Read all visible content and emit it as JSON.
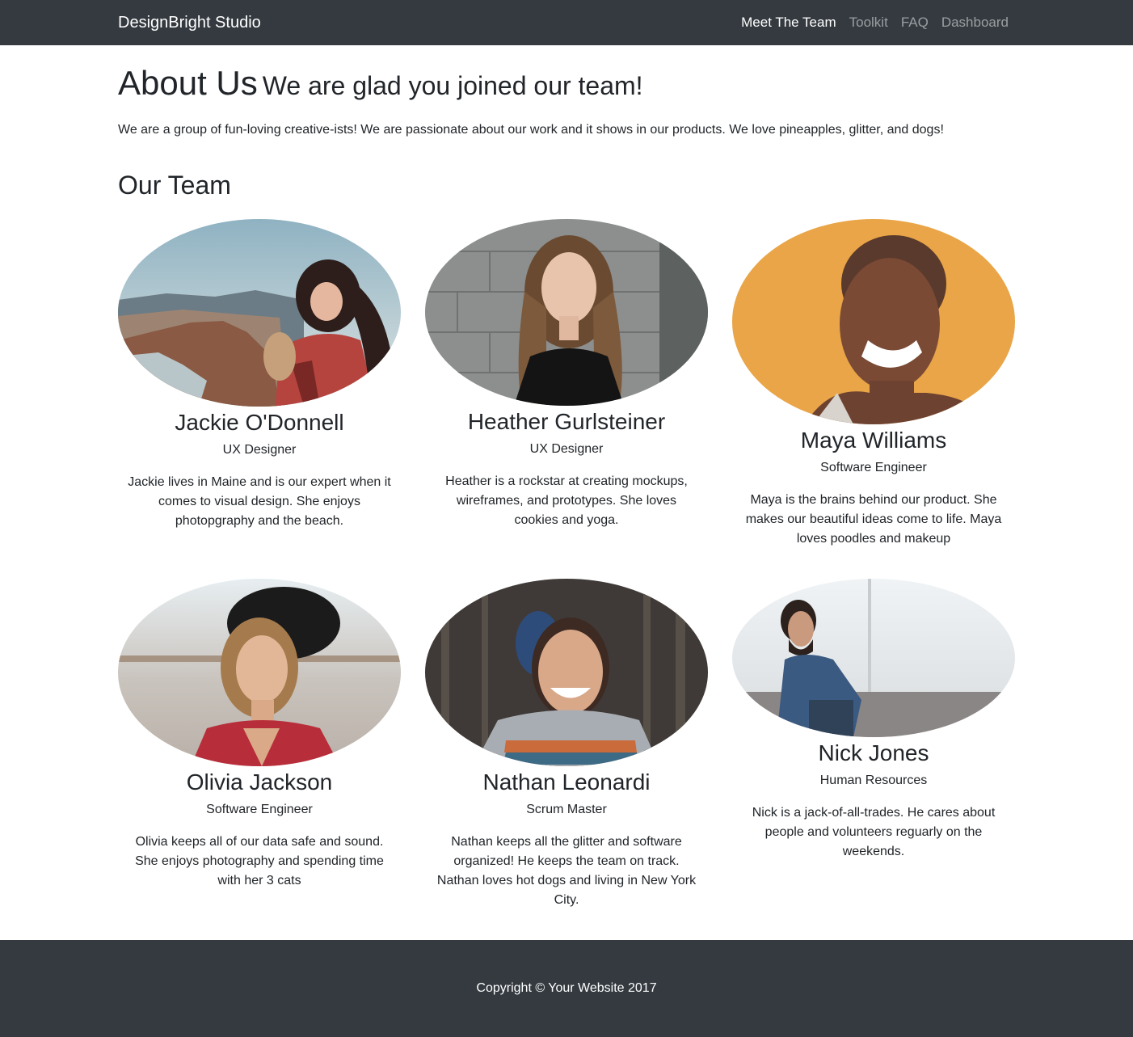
{
  "nav": {
    "brand": "DesignBright Studio",
    "links": [
      "Meet The Team",
      "Toolkit",
      "FAQ",
      "Dashboard"
    ]
  },
  "about": {
    "title": "About Us",
    "subtitle": "We are glad you joined our team!",
    "intro": "We are a group of fun-loving creative-ists! We are passionate about our work and it shows in our products. We love pineapples, glitter, and dogs!"
  },
  "team": {
    "heading": "Our Team",
    "members": [
      {
        "name": "Jackie O'Donnell",
        "role": "UX Designer",
        "bio": [
          "Jackie lives in Maine and is our expert when it",
          "comes to visual design. She enjoys",
          "photopgraphy and the beach."
        ]
      },
      {
        "name": "Heather Gurlsteiner",
        "role": "UX Designer",
        "bio": [
          "Heather is a rockstar at creating mockups,",
          "wireframes, and prototypes. She loves",
          "cookies and yoga."
        ]
      },
      {
        "name": "Maya Williams",
        "role": "Software Engineer",
        "bio": [
          "Maya is the brains behind our product. She",
          "makes our beautiful ideas come to life. Maya",
          "loves poodles and makeup"
        ]
      },
      {
        "name": "Olivia Jackson",
        "role": "Software Engineer",
        "bio": [
          "Olivia keeps all of our data safe and sound.",
          "She enjoys photography and spending time",
          "with her 3 cats"
        ]
      },
      {
        "name": "Nathan Leonardi",
        "role": "Scrum Master",
        "bio": [
          "Nathan keeps all the glitter and software",
          "organized! He keeps the team on track.",
          "Nathan loves hot dogs and living in New York",
          "City."
        ]
      },
      {
        "name": "Nick Jones",
        "role": "Human Resources",
        "bio": [
          "Nick is a jack-of-all-trades. He cares about",
          "people and volunteers reguarly on the",
          "weekends."
        ]
      }
    ]
  },
  "footer": {
    "copyright": "Copyright © Your Website 2017"
  },
  "colors": {
    "navbar": "#343a40",
    "text": "#212529"
  }
}
